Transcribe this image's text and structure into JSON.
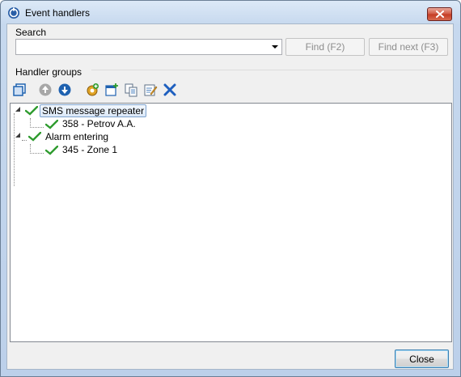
{
  "window": {
    "title": "Event handlers"
  },
  "search": {
    "label": "Search",
    "value": "",
    "find_label": "Find (F2)",
    "find_next_label": "Find next (F3)"
  },
  "handlers": {
    "group_label": "Handler groups",
    "toolbar": [
      "new-window-icon",
      "move-up-icon",
      "move-down-icon",
      "add-handler-icon",
      "add-group-icon",
      "copy-icon",
      "edit-icon",
      "delete-icon"
    ],
    "tree": [
      {
        "label": "SMS message repeater",
        "checked": true,
        "children": [
          {
            "label": "358 - Petrov A.A.",
            "checked": true
          }
        ]
      },
      {
        "label": "Alarm entering",
        "checked": true,
        "children": [
          {
            "label": "345 - Zone 1",
            "checked": true
          }
        ]
      }
    ]
  },
  "footer": {
    "close_label": "Close"
  },
  "colors": {
    "check": "#2e9b2e",
    "accent": "#1f62b0",
    "delete": "#1e5fbf"
  }
}
